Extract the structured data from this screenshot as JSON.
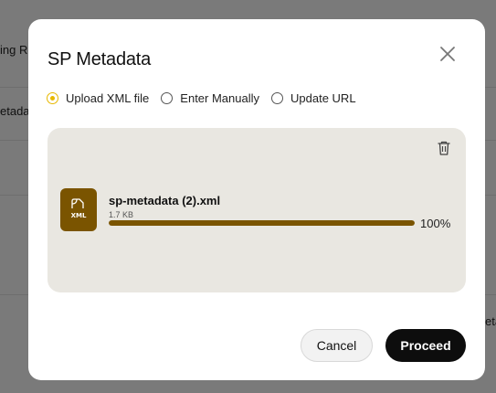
{
  "background": {
    "fragments": [
      "ing Re",
      "etada",
      "eta"
    ]
  },
  "modal": {
    "title": "SP Metadata",
    "close_icon": "close-icon",
    "radio_options": [
      {
        "label": "Upload XML file",
        "selected": true
      },
      {
        "label": "Enter Manually",
        "selected": false
      },
      {
        "label": "Update URL",
        "selected": false
      }
    ],
    "file": {
      "icon": "xml-file-icon",
      "icon_text": "XML",
      "name": "sp-metadata (2).xml",
      "size": "1.7 KB",
      "progress": 1.0,
      "progress_text": "100%",
      "delete_icon": "trash-icon"
    },
    "buttons": {
      "cancel": "Cancel",
      "proceed": "Proceed"
    }
  },
  "colors": {
    "accent_radio": "#e7b800",
    "file_brown": "#7a5400",
    "upload_bg": "#e9e7e1",
    "primary_button": "#0d0d0d"
  }
}
